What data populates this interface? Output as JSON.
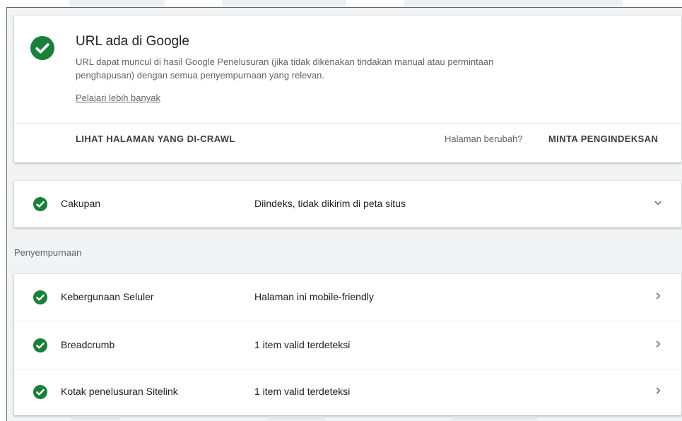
{
  "summary": {
    "title": "URL ada di Google",
    "description": "URL dapat muncul di hasil Google Penelusuran (jika tidak dikenakan tindakan manual atau permintaan penghapusan) dengan semua penyempurnaan yang relevan.",
    "learn_more": "Pelajari lebih banyak",
    "view_crawled_label": "LIHAT HALAMAN YANG DI-CRAWL",
    "page_changed_label": "Halaman berubah?",
    "request_indexing_label": "MINTA PENGINDEKSAN"
  },
  "coverage": {
    "label": "Cakupan",
    "value": "Diindeks, tidak dikirim di peta situs",
    "icon": "chevron-down-icon"
  },
  "enhancements": {
    "section_label": "Penyempurnaan",
    "items": [
      {
        "label": "Kebergunaan Seluler",
        "value": "Halaman ini mobile-friendly",
        "icon": "chevron-right-icon"
      },
      {
        "label": "Breadcrumb",
        "value": "1 item valid terdeteksi",
        "icon": "chevron-right-icon"
      },
      {
        "label": "Kotak penelusuran Sitelink",
        "value": "1 item valid terdeteksi",
        "icon": "chevron-right-icon"
      }
    ]
  },
  "colors": {
    "success_green": "#188038",
    "background": "#f1f3f4"
  }
}
